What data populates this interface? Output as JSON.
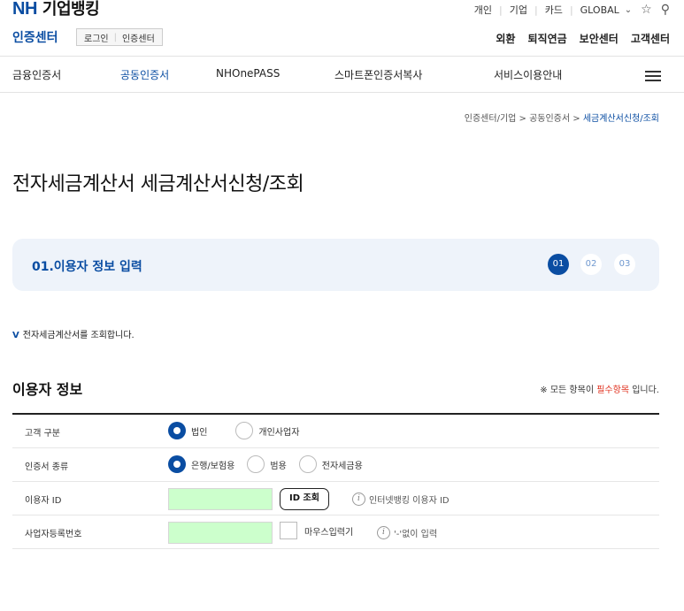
{
  "brand": {
    "logo": "NH",
    "logo_ko": "기업뱅킹"
  },
  "util_nav": {
    "items": [
      "개인",
      "기업",
      "카드",
      "GLOBAL"
    ]
  },
  "cert_header": {
    "title": "인증센터",
    "links": [
      "로그인",
      "인증센터"
    ],
    "right_menu": [
      "외환",
      "퇴직연금",
      "보안센터",
      "고객센터"
    ]
  },
  "gnb": {
    "items": [
      "금융인증서",
      "공동인증서",
      "NHOnePASS",
      "스마트폰인증서복사",
      "서비스이용안내"
    ],
    "active_index": 1
  },
  "breadcrumb": {
    "path": "인증센터/기업 > 공동인증서 > ",
    "current": "세금계산서신청/조회"
  },
  "page_title": "전자세금계산서 세금계산서신청/조회",
  "steps": {
    "label": "01.이용자 정보 입력",
    "items": [
      "01",
      "02",
      "03"
    ],
    "current_index": 0
  },
  "notice": {
    "mark": "V",
    "text": "전자세금계산서를 조회합니다."
  },
  "section": {
    "title": "이용자 정보",
    "req_prefix": "※ 모든 항목이 ",
    "req_highlight": "필수항목",
    "req_suffix": " 입니다."
  },
  "form": {
    "customer_type": {
      "label": "고객 구분",
      "options": [
        "법인",
        "개인사업자"
      ],
      "selected": 0
    },
    "cert_type": {
      "label": "인증서 종류",
      "options": [
        "은행/보험용",
        "범용",
        "전자세금용"
      ],
      "selected": 0
    },
    "user_id": {
      "label": "이용자 ID",
      "value": "",
      "button": "ID 조회",
      "hint": "인터넷뱅킹 이용자 ID"
    },
    "biz_no": {
      "label": "사업자등록번호",
      "value": "",
      "checkbox_label": "마우스입력기",
      "hint": "'-'없이 입력"
    }
  },
  "colors": {
    "brand": "#0a4da2",
    "required": "#e0301e",
    "input_fill": "#ccffcc",
    "step_bg": "#eef3fa"
  }
}
